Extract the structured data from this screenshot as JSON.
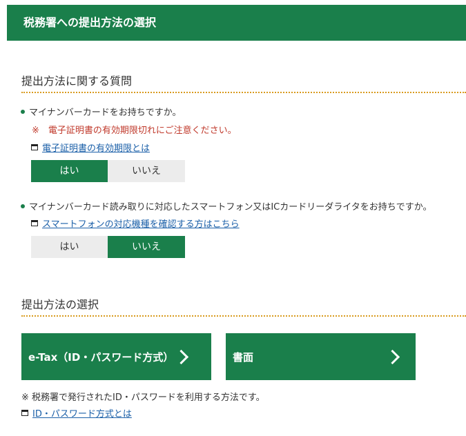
{
  "header": {
    "title": "税務署への提出方法の選択"
  },
  "questions_section": {
    "title": "提出方法に関する質問",
    "q1": {
      "text": "マイナンバーカードをお持ちですか。",
      "warning": "※　電子証明書の有効期限切れにご注意ください。",
      "link": "電子証明書の有効期限とは",
      "yes": "はい",
      "no": "いいえ",
      "selected": "はい"
    },
    "q2": {
      "text": "マイナンバーカード読み取りに対応したスマートフォン又はICカードリーダライタをお持ちですか。",
      "link": "スマートフォンの対応機種を確認する方はこちら",
      "yes": "はい",
      "no": "いいえ",
      "selected": "いいえ"
    }
  },
  "method_section": {
    "title": "提出方法の選択",
    "etax_button": "e-Tax（ID・パスワード方式）",
    "paper_button": "書面",
    "note": "※  税務署で発行されたID・パスワードを利用する方法です。",
    "link": "ID・パスワード方式とは"
  },
  "colors": {
    "primary": "#1a7f4b",
    "link": "#1a5fa8",
    "warning": "#c0392b",
    "divider": "#d89a1c"
  }
}
